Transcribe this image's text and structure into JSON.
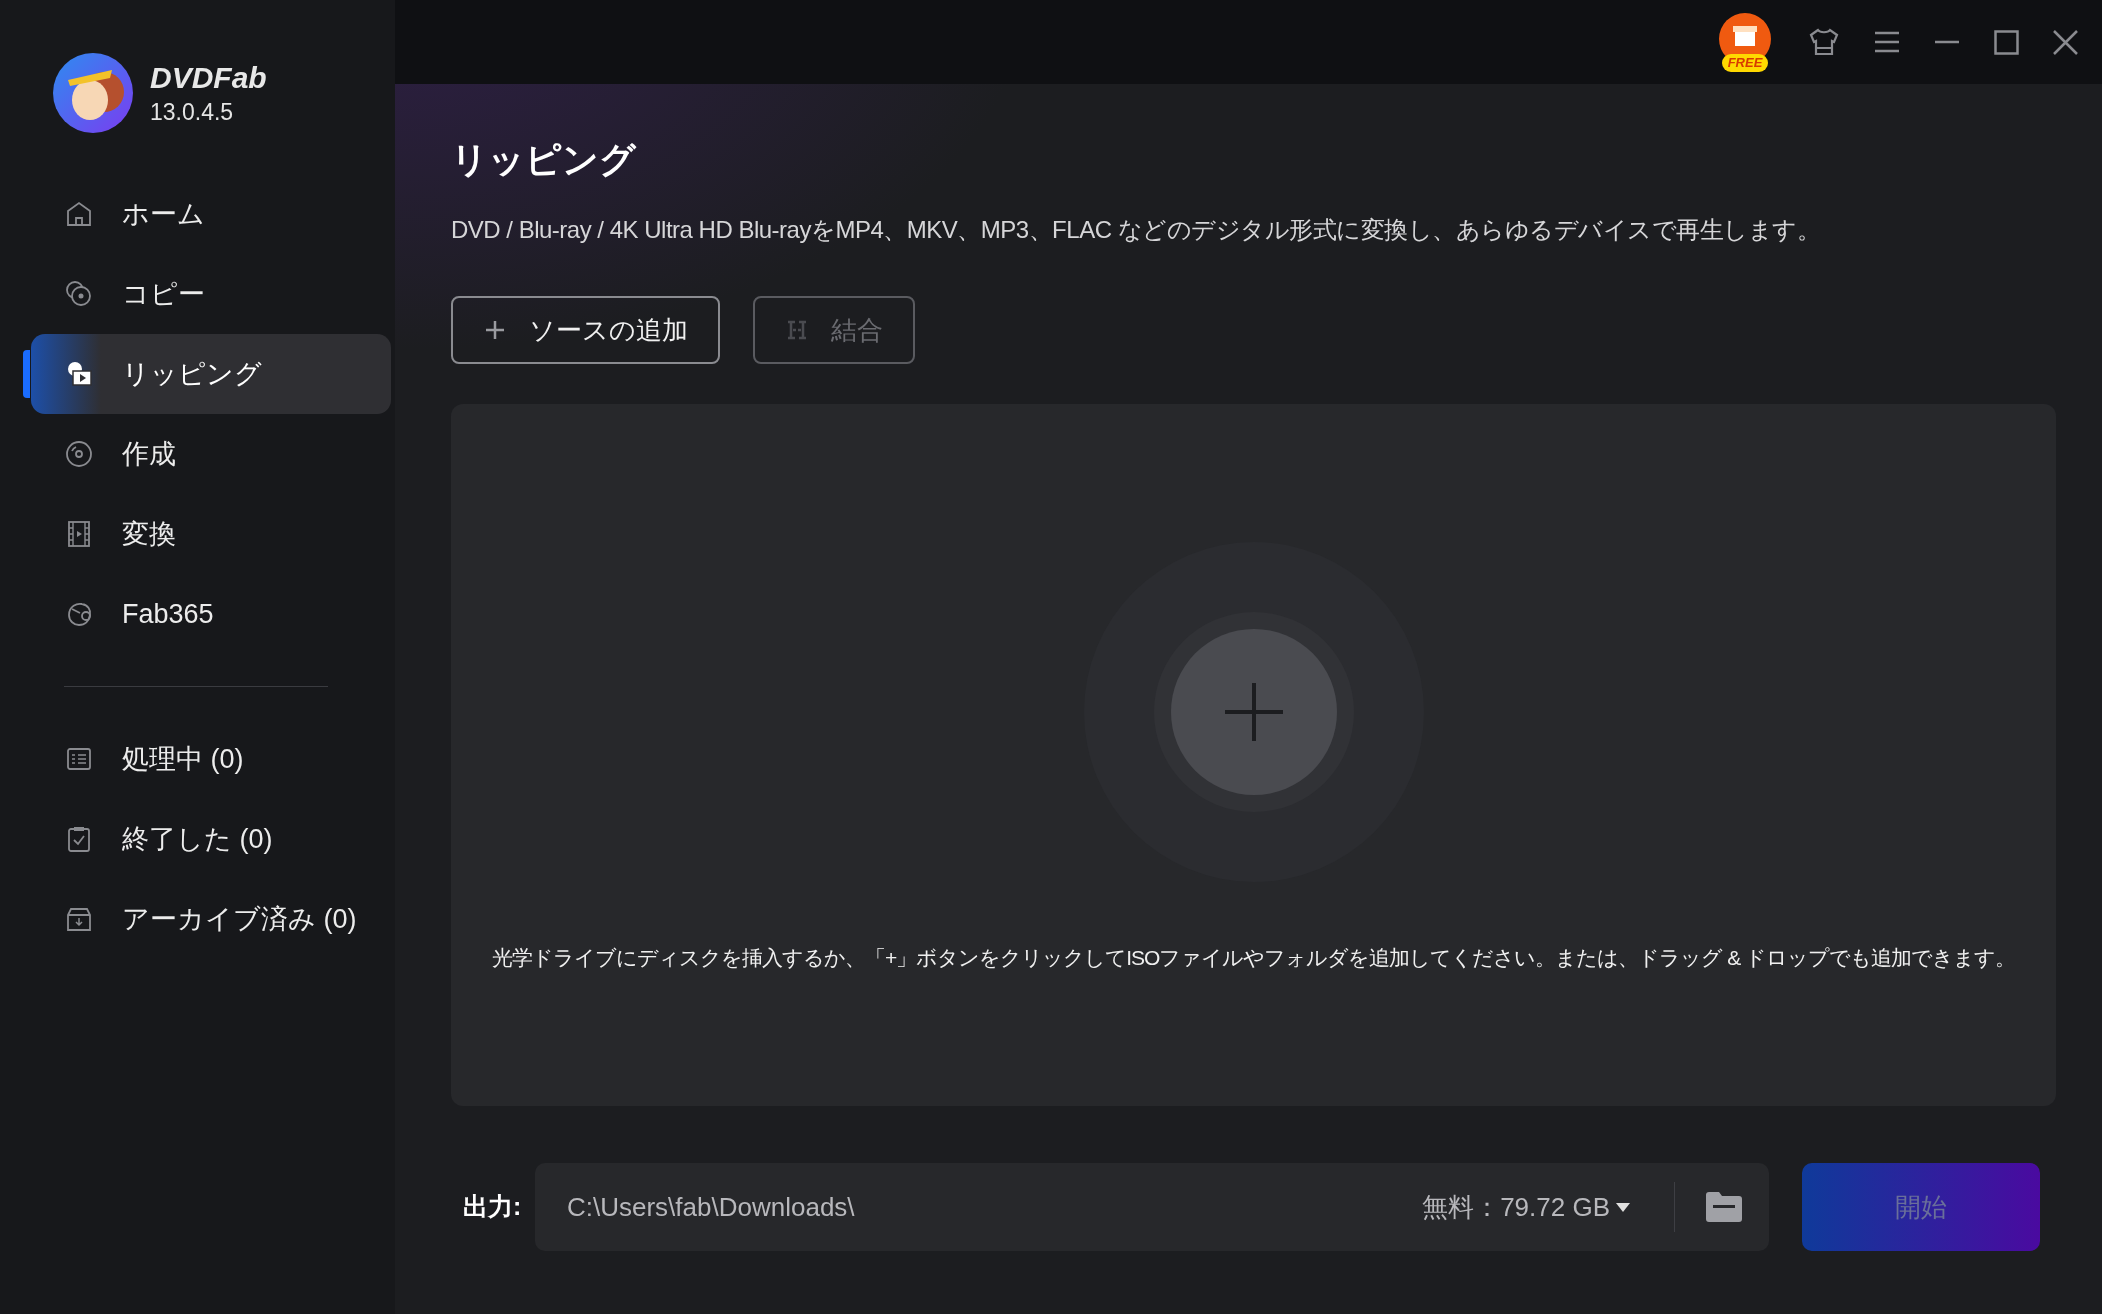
{
  "app": {
    "name": "DVDFab",
    "version": "13.0.4.5"
  },
  "nav": [
    {
      "label": "ホーム",
      "kind": "home",
      "selected": false
    },
    {
      "label": "コピー",
      "kind": "copy",
      "selected": false
    },
    {
      "label": "リッピング",
      "kind": "rip",
      "selected": true
    },
    {
      "label": "作成",
      "kind": "disc",
      "selected": false
    },
    {
      "label": "変換",
      "kind": "film",
      "selected": false
    },
    {
      "label": "Fab365",
      "kind": "fab",
      "selected": false
    }
  ],
  "queues": [
    {
      "label": "処理中 (0)",
      "kind": "list"
    },
    {
      "label": "終了した (0)",
      "kind": "clipboard"
    },
    {
      "label": "アーカイブ済み (0)",
      "kind": "archive"
    }
  ],
  "promo_badge": "FREE",
  "page": {
    "title": "リッピング",
    "description": "DVD / Blu-ray / 4K Ultra HD Blu-rayをMP4、MKV、MP3、FLAC などのデジタル形式に変換し、あらゆるデバイスで再生します。"
  },
  "actions": [
    {
      "label": "ソースの追加",
      "kind": "plus",
      "disabled": false
    },
    {
      "label": "結合",
      "kind": "merge",
      "disabled": true
    }
  ],
  "drop_hint": "光学ドライブにディスクを挿入するか、「+」ボタンをクリックしてISOファイルやフォルダを追加してください。または、ドラッグ & ドロップでも追加できます。",
  "output": {
    "label": "出力:",
    "path": "C:\\Users\\fab\\Downloads\\",
    "free_space": "無料：79.72 GB"
  },
  "start_button": {
    "label": "開始",
    "disabled": true
  }
}
